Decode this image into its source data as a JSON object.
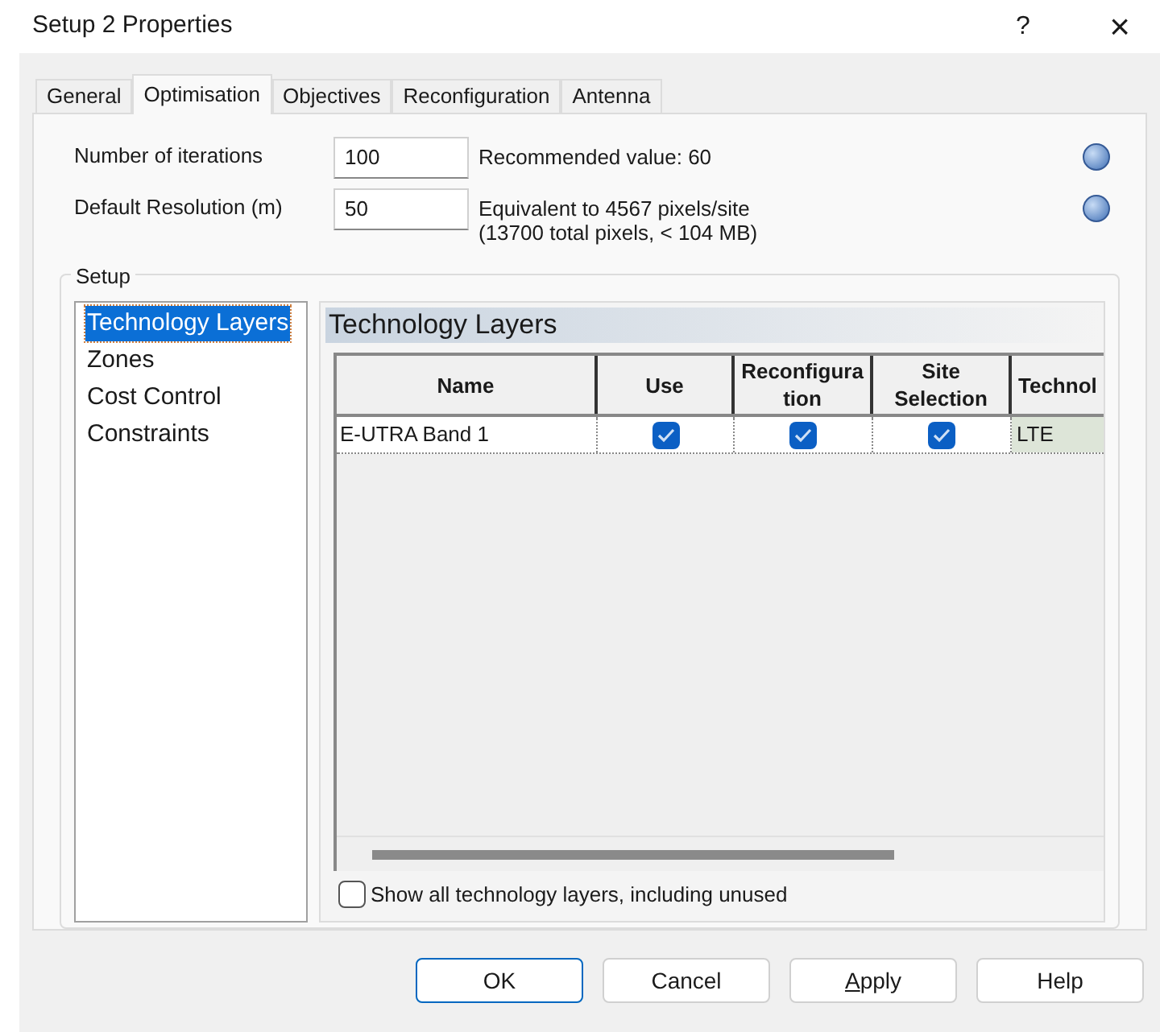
{
  "window": {
    "title": "Setup 2 Properties",
    "help": "?",
    "close": "×"
  },
  "tabs": [
    {
      "label": "General",
      "selected": false
    },
    {
      "label": "Optimisation",
      "selected": true
    },
    {
      "label": "Objectives",
      "selected": false
    },
    {
      "label": "Reconfiguration",
      "selected": false
    },
    {
      "label": "Antenna",
      "selected": false
    }
  ],
  "settings": [
    {
      "label": "Number of iterations",
      "value": "100",
      "note": [
        "Recommended value: 60"
      ]
    },
    {
      "label": "Default Resolution (m)",
      "value": "50",
      "note": [
        "Equivalent to 4567 pixels/site",
        "(13700 total pixels, < 104 MB)"
      ]
    }
  ],
  "setup": {
    "title": "Setup",
    "items": [
      {
        "label": "Technology Layers",
        "selected": true
      },
      {
        "label": "Zones",
        "selected": false
      },
      {
        "label": "Cost Control",
        "selected": false
      },
      {
        "label": "Constraints",
        "selected": false
      }
    ],
    "panel_title": "Technology Layers",
    "table": {
      "columns": [
        "Name",
        "Use",
        "Reconfigura tion",
        "Site Selection",
        "Technol"
      ],
      "rows": [
        {
          "name": "E-UTRA Band 1",
          "use": true,
          "reconfiguration": true,
          "site_selection": true,
          "technology": "LTE"
        }
      ]
    },
    "show_all": {
      "label": "Show all technology layers, including unused",
      "checked": false
    }
  },
  "buttons": [
    {
      "label": "OK",
      "default": true,
      "mnemonic": false
    },
    {
      "label": "Cancel",
      "default": false,
      "mnemonic": false
    },
    {
      "label": "Apply",
      "default": false,
      "mnemonic": true
    },
    {
      "label": "Help",
      "default": false,
      "mnemonic": false
    }
  ]
}
